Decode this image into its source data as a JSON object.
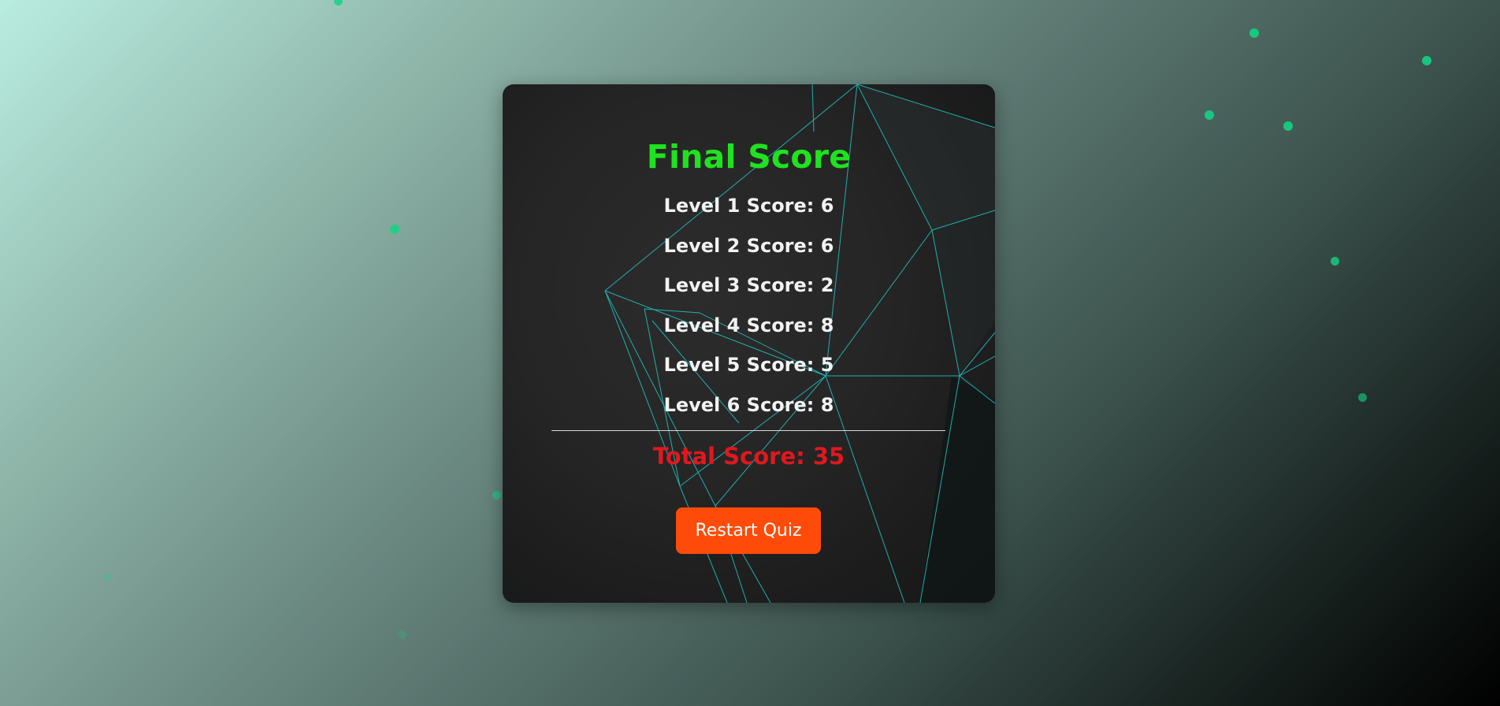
{
  "final_score": {
    "title": "Final Score",
    "levels": [
      {
        "label": "Level 1 Score: 6"
      },
      {
        "label": "Level 2 Score: 6"
      },
      {
        "label": "Level 3 Score: 2"
      },
      {
        "label": "Level 4 Score: 8"
      },
      {
        "label": "Level 5 Score: 5"
      },
      {
        "label": "Level 6 Score: 8"
      }
    ],
    "total": "Total Score: 35",
    "restart_label": "Restart Quiz"
  },
  "colors": {
    "title": "#1fe31f",
    "total": "#e0181e",
    "button": "#ff4b09",
    "mesh_lines": "#22c6c6",
    "particles": "#14d384"
  }
}
